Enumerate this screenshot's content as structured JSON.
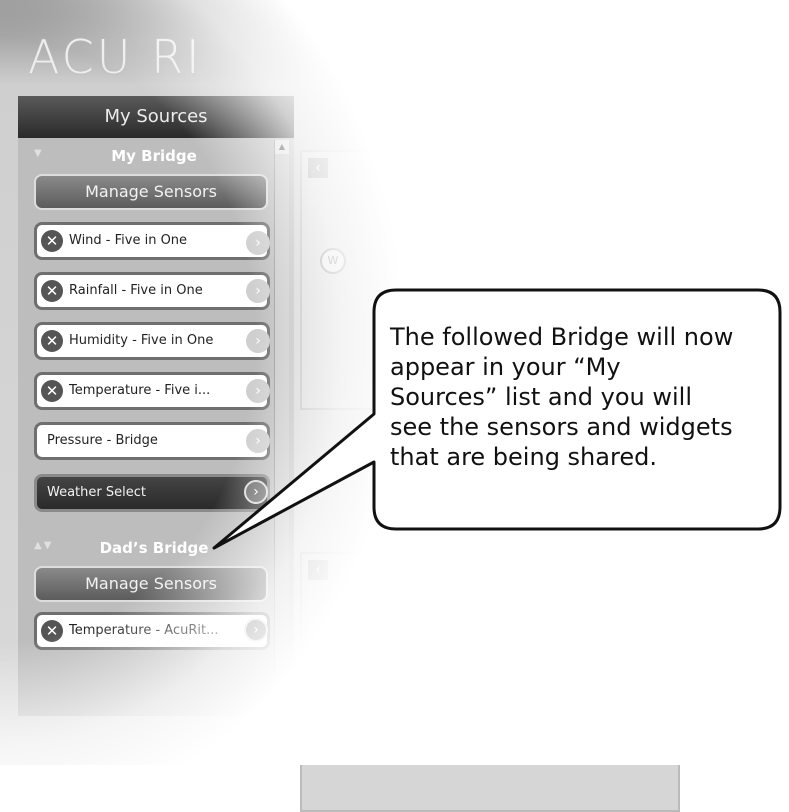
{
  "app": {
    "logo_text": "ACU RI"
  },
  "sidebar": {
    "title": "My Sources",
    "groups": [
      {
        "name": "My Bridge",
        "manage_label": "Manage Sensors",
        "items": [
          {
            "label": "Wind - Five in One"
          },
          {
            "label": "Rainfall - Five in One"
          },
          {
            "label": "Humidity - Five in One"
          },
          {
            "label": "Temperature - Five i..."
          },
          {
            "label": "Pressure - Bridge"
          },
          {
            "label": "Weather Select"
          }
        ]
      },
      {
        "name": "Dad’s Bridge",
        "manage_label": "Manage Sensors",
        "items": [
          {
            "label": "Temperature - AcuRit..."
          }
        ]
      }
    ]
  },
  "widget": {
    "compass_letter": "W"
  },
  "callout": {
    "line1": "The followed Bridge will now",
    "line2": "appear in your “My",
    "line3": "Sources” list and you will",
    "line4": "see the sensors and widgets",
    "line5": "that are being shared."
  },
  "icons": {
    "remove": "remove-x-icon",
    "go": "chevron-right-circle-icon",
    "collapse": "triangle-down-icon",
    "reorder": "triangle-up-down-icon"
  }
}
